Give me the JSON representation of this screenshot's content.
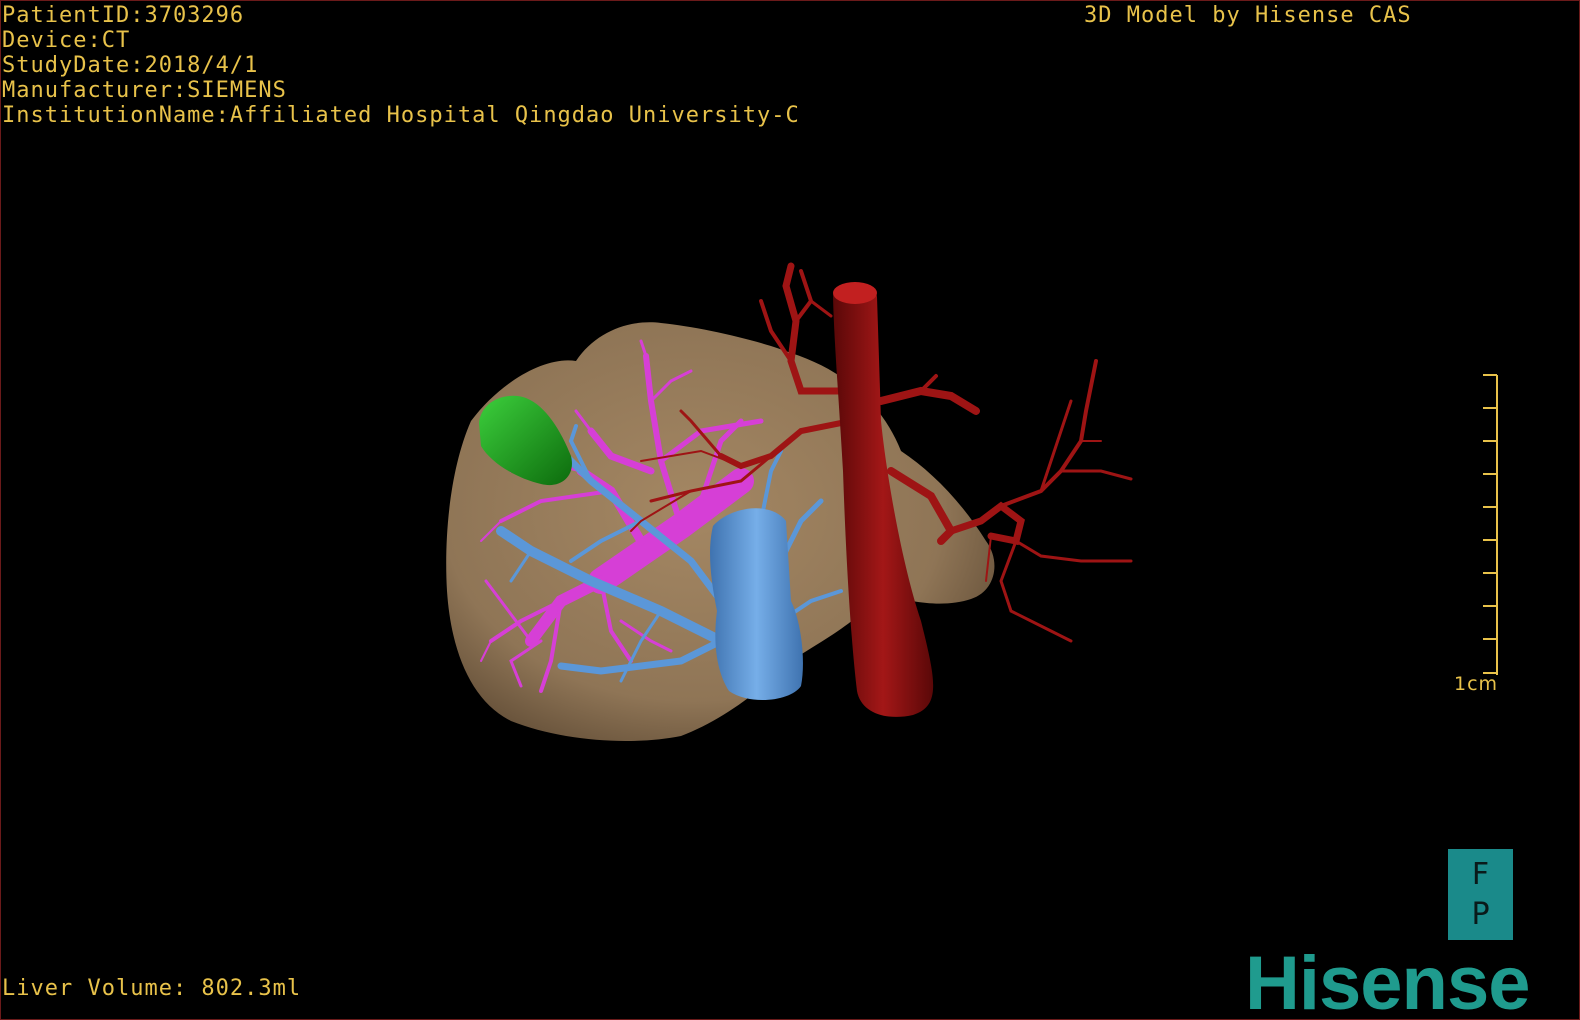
{
  "patient_info": {
    "patient_id": "PatientID:3703296",
    "device": "Device:CT",
    "study_date": "StudyDate:2018/4/1",
    "manufacturer": "Manufacturer:SIEMENS",
    "institution": "InstitutionName:Affiliated Hospital Qingdao University-C"
  },
  "credit": "3D Model by Hisense CAS",
  "liver_volume": "Liver Volume: 802.3ml",
  "scale_bar": {
    "label": "1cm",
    "ticks": 10
  },
  "orientation": {
    "top": "F",
    "bottom": "P"
  },
  "logo": "Hisense",
  "colors": {
    "overlay_text": "#e8c24a",
    "liver": "#8f7556",
    "artery": "#8f1212",
    "portal_vein": "#d63fd6",
    "hepatic_vein": "#5b97d8",
    "gallbladder": "#1aa31a",
    "orientation_box": "#1a8a8a",
    "logo": "#1f9b8e"
  }
}
